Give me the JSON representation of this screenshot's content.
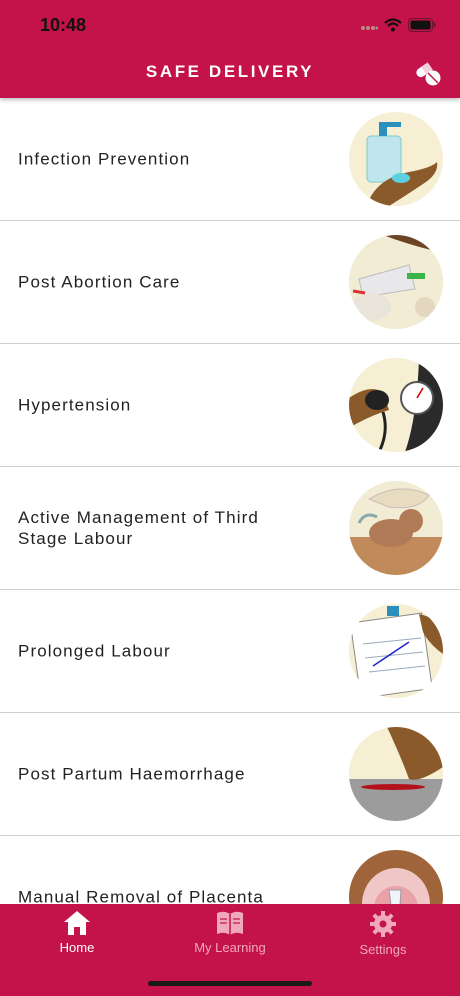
{
  "status_bar": {
    "time": "10:48"
  },
  "header": {
    "title": "SAFE DELIVERY",
    "action_icon": "pills-icon"
  },
  "modules": [
    {
      "label": "Infection Prevention",
      "icon": "hand-sanitizer-illustration"
    },
    {
      "label": "Post Abortion Care",
      "icon": "post-abortion-care-illustration"
    },
    {
      "label": "Hypertension",
      "icon": "blood-pressure-cuff-illustration"
    },
    {
      "label": "Active Management of Third Stage Labour",
      "icon": "newborn-illustration"
    },
    {
      "label": "Prolonged Labour",
      "icon": "partograph-illustration"
    },
    {
      "label": "Post Partum Haemorrhage",
      "icon": "haemorrhage-illustration"
    },
    {
      "label": "Manual Removal of Placenta",
      "icon": "placenta-illustration"
    }
  ],
  "tabbar": {
    "items": [
      {
        "label": "Home",
        "icon": "home-icon",
        "active": true
      },
      {
        "label": "My Learning",
        "icon": "book-icon",
        "active": false
      },
      {
        "label": "Settings",
        "icon": "gear-icon",
        "active": false
      }
    ]
  },
  "colors": {
    "brand": "#c4124b",
    "tab_inactive": "#f0a8bd",
    "text": "#222222",
    "divider": "#cfcfcf"
  }
}
